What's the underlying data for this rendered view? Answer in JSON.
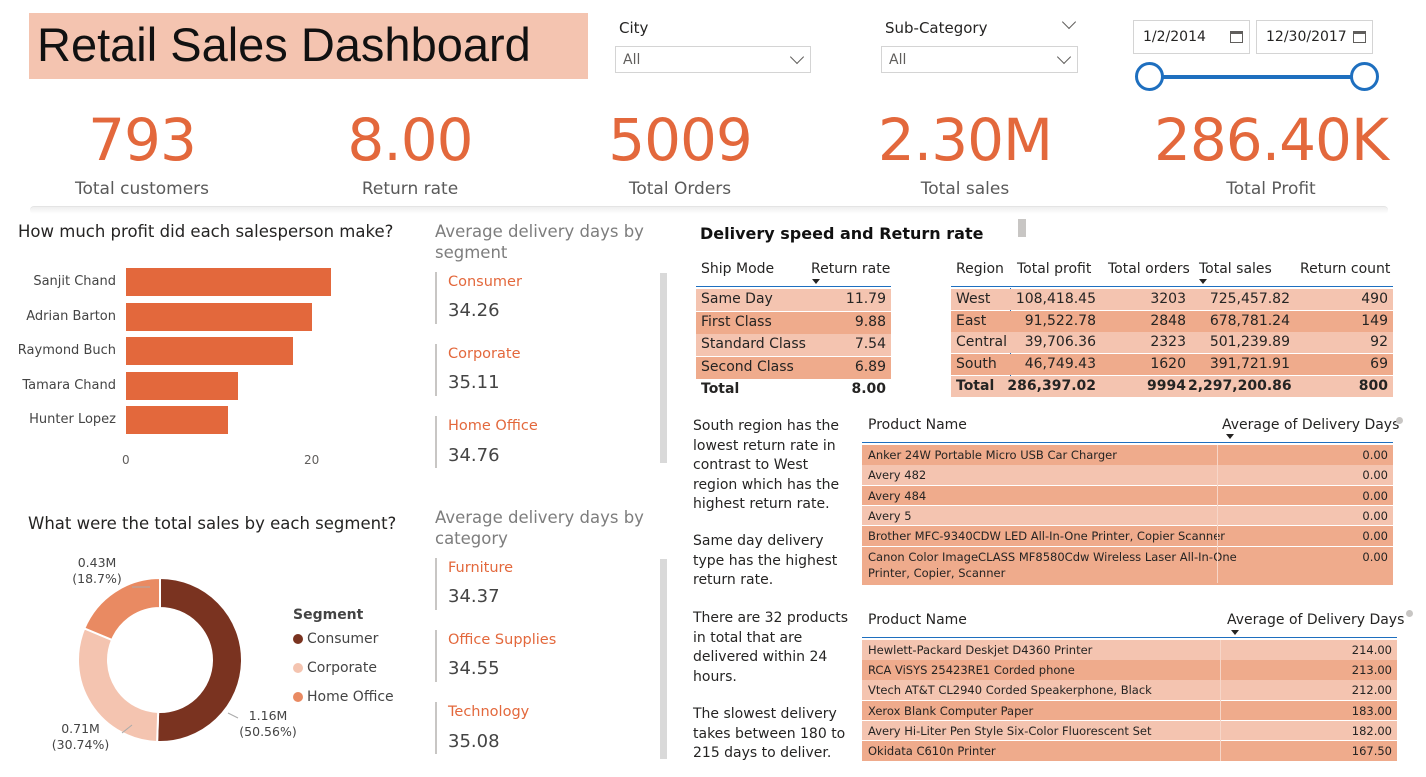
{
  "title": "Retail Sales Dashboard",
  "slicers": {
    "city": {
      "label": "City",
      "value": "All"
    },
    "subcategory": {
      "label": "Sub-Category",
      "value": "All"
    },
    "date_start": "1/2/2014",
    "date_end": "12/30/2017"
  },
  "kpis": [
    {
      "value": "793",
      "label": "Total customers"
    },
    {
      "value": "8.00",
      "label": "Return rate"
    },
    {
      "value": "5009",
      "label": "Total Orders"
    },
    {
      "value": "2.30M",
      "label": "Total sales"
    },
    {
      "value": "286.40K",
      "label": "Total Profit"
    }
  ],
  "salesperson_chart": {
    "title": "How much profit did each salesperson make?",
    "names": [
      "Sanjit Chand",
      "Adrian Barton",
      "Raymond Buch",
      "Tamara Chand",
      "Hunter Lopez"
    ],
    "values": [
      22.0,
      20.0,
      18.0,
      12.0,
      11.0
    ],
    "ticks": [
      "0",
      "20"
    ]
  },
  "delivery_segment": {
    "title": "Average delivery days by segment",
    "cards": [
      {
        "name": "Consumer",
        "value": "34.26"
      },
      {
        "name": "Corporate",
        "value": "35.11"
      },
      {
        "name": "Home Office",
        "value": "34.76"
      }
    ]
  },
  "delivery_category": {
    "title": "Average delivery days by category",
    "cards": [
      {
        "name": "Furniture",
        "value": "34.37"
      },
      {
        "name": "Office Supplies",
        "value": "34.55"
      },
      {
        "name": "Technology",
        "value": "35.08"
      }
    ]
  },
  "segment_chart": {
    "title": "What were the total sales by each segment?",
    "legend_title": "Segment",
    "legend": [
      "Consumer",
      "Corporate",
      "Home Office"
    ],
    "colors": [
      "#7a3320",
      "#f4c4b0",
      "#e98a62"
    ],
    "labels": [
      {
        "line1": "1.16M",
        "line2": "(50.56%)"
      },
      {
        "line1": "0.71M",
        "line2": "(30.74%)"
      },
      {
        "line1": "0.43M",
        "line2": "(18.7%)"
      }
    ]
  },
  "chart_data": {
    "type": "pie",
    "title": "What were the total sales by each segment?",
    "categories": [
      "Consumer",
      "Corporate",
      "Home Office"
    ],
    "values": [
      1.16,
      0.71,
      0.43
    ],
    "percents": [
      50.56,
      30.74,
      18.7
    ],
    "legend_title": "Segment",
    "legend_position": "right"
  },
  "speed_section": {
    "title": "Delivery speed and Return rate",
    "ship_table": {
      "headers": [
        "Ship Mode",
        "Return rate"
      ],
      "rows": [
        [
          "Same Day",
          "11.79"
        ],
        [
          "First Class",
          "9.88"
        ],
        [
          "Standard Class",
          "7.54"
        ],
        [
          "Second Class",
          "6.89"
        ]
      ],
      "total": [
        "Total",
        "8.00"
      ]
    },
    "region_table": {
      "headers": [
        "Region",
        "Total profit",
        "Total orders",
        "Total sales",
        "Return count"
      ],
      "rows": [
        [
          "West",
          "108,418.45",
          "3203",
          "725,457.82",
          "490"
        ],
        [
          "East",
          "91,522.78",
          "2848",
          "678,781.24",
          "149"
        ],
        [
          "Central",
          "39,706.36",
          "2323",
          "501,239.89",
          "92"
        ],
        [
          "South",
          "46,749.43",
          "1620",
          "391,721.91",
          "69"
        ]
      ],
      "total": [
        "Total",
        "286,397.02",
        "9994",
        "2,297,200.86",
        "800"
      ]
    }
  },
  "insights": [
    "South region has the lowest return rate in contrast to West region which has the highest return rate.",
    "Same day delivery type has the highest return rate.",
    "There are 32 products in total that are delivered within 24 hours.",
    "The slowest delivery takes between 180 to 215 days to deliver."
  ],
  "fast_products": {
    "headers": [
      "Product Name",
      "Average of Delivery Days"
    ],
    "rows": [
      [
        "Anker 24W Portable Micro USB Car Charger",
        "0.00"
      ],
      [
        "Avery 482",
        "0.00"
      ],
      [
        "Avery 484",
        "0.00"
      ],
      [
        "Avery 5",
        "0.00"
      ],
      [
        "Brother MFC-9340CDW LED All-In-One Printer, Copier Scanner",
        "0.00"
      ],
      [
        "Canon Color ImageCLASS MF8580Cdw Wireless Laser All-In-One",
        "0.00"
      ]
    ],
    "wrap_line": "Printer, Copier, Scanner"
  },
  "slow_products": {
    "headers": [
      "Product Name",
      "Average of Delivery Days"
    ],
    "rows": [
      [
        "Hewlett-Packard Deskjet D4360 Printer",
        "214.00"
      ],
      [
        "RCA ViSYS 25423RE1 Corded phone",
        "213.00"
      ],
      [
        "Vtech AT&T CL2940 Corded Speakerphone, Black",
        "212.00"
      ],
      [
        "Xerox Blank Computer Paper",
        "183.00"
      ],
      [
        "Avery Hi-Liter Pen Style Six-Color Fluorescent Set",
        "182.00"
      ],
      [
        "Okidata C610n Printer",
        "167.50"
      ]
    ]
  }
}
